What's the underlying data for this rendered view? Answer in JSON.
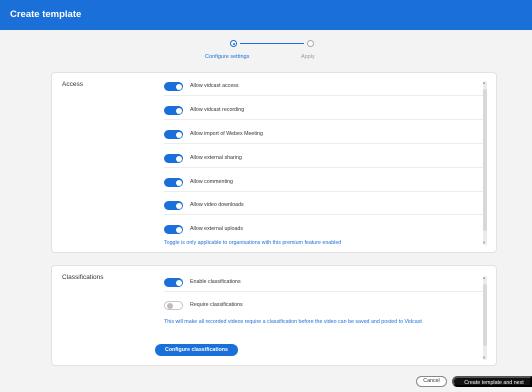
{
  "window": {
    "title": "Create template"
  },
  "stepper": {
    "steps": [
      {
        "label": "Configure settings",
        "state": "active"
      },
      {
        "label": "Apply",
        "state": "pending"
      }
    ]
  },
  "access": {
    "title": "Access",
    "toggles": [
      {
        "label": "Allow vidcast access",
        "on": true
      },
      {
        "label": "Allow vidcast recording",
        "on": true
      },
      {
        "label": "Allow import of Webex Meeting",
        "on": true
      },
      {
        "label": "Allow external sharing",
        "on": true
      },
      {
        "label": "Allow commenting",
        "on": true
      },
      {
        "label": "Allow video downloads",
        "on": true
      },
      {
        "label": "Allow external uploads",
        "on": true
      }
    ],
    "note": "Toggle is only applicable to organisations with this premium feature enabled"
  },
  "classifications": {
    "title": "Classifications",
    "toggles": [
      {
        "label": "Enable classifications",
        "on": true
      },
      {
        "label": "Require classifications",
        "on": false
      }
    ],
    "note": "This will make all recorded videos require a classification before the video can be saved and posted to Vidcast",
    "configure_label": "Configure classifications"
  },
  "footer": {
    "cancel_label": "Cancel",
    "create_label": "Create template and next"
  },
  "colors": {
    "accent": "#1a6fd9",
    "header": "#1a6fd9",
    "dark_button": "#111111"
  }
}
